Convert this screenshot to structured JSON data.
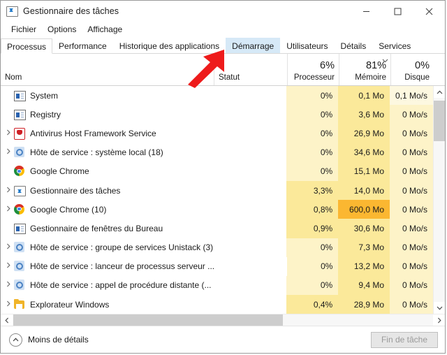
{
  "window": {
    "title": "Gestionnaire des tâches",
    "title_icon": "task-manager-icon",
    "minimize": "–",
    "maximize": "☐",
    "close": "✕"
  },
  "menubar": {
    "items": [
      {
        "label": "Fichier"
      },
      {
        "label": "Options"
      },
      {
        "label": "Affichage"
      }
    ]
  },
  "tabs": [
    {
      "label": "Processus",
      "state": "active"
    },
    {
      "label": "Performance",
      "state": "normal"
    },
    {
      "label": "Historique des applications",
      "state": "normal"
    },
    {
      "label": "Démarrage",
      "state": "hover"
    },
    {
      "label": "Utilisateurs",
      "state": "normal"
    },
    {
      "label": "Détails",
      "state": "normal"
    },
    {
      "label": "Services",
      "state": "normal"
    }
  ],
  "columns": [
    {
      "name": "Nom",
      "value": "",
      "sorted": false
    },
    {
      "name": "Statut",
      "value": "",
      "sorted": false
    },
    {
      "name": "Processeur",
      "value": "6%",
      "sorted": false
    },
    {
      "name": "Mémoire",
      "value": "81%",
      "sorted": true,
      "sort_icon": "chevron-down-icon"
    },
    {
      "name": "Disque",
      "value": "0%",
      "sorted": false
    }
  ],
  "processes": [
    {
      "name": "System",
      "icon": "windows-process-icon",
      "expandable": false,
      "status": "",
      "cpu": "0%",
      "memory": "0,1 Mo",
      "disk": "0,1 Mo/s"
    },
    {
      "name": "Registry",
      "icon": "windows-process-icon",
      "expandable": false,
      "status": "",
      "cpu": "0%",
      "memory": "3,6 Mo",
      "disk": "0 Mo/s"
    },
    {
      "name": "Antivirus Host Framework Service",
      "icon": "shield-icon",
      "expandable": true,
      "status": "",
      "cpu": "0%",
      "memory": "26,9 Mo",
      "disk": "0 Mo/s"
    },
    {
      "name": "Hôte de service : système local (18)",
      "icon": "gear-icon",
      "expandable": true,
      "status": "",
      "cpu": "0%",
      "memory": "34,6 Mo",
      "disk": "0 Mo/s"
    },
    {
      "name": "Google Chrome",
      "icon": "chrome-icon",
      "expandable": false,
      "status": "",
      "cpu": "0%",
      "memory": "15,1 Mo",
      "disk": "0 Mo/s"
    },
    {
      "name": "Gestionnaire des tâches",
      "icon": "task-manager-icon",
      "expandable": true,
      "status": "",
      "cpu": "3,3%",
      "memory": "14,0 Mo",
      "disk": "0 Mo/s"
    },
    {
      "name": "Google Chrome (10)",
      "icon": "chrome-icon",
      "expandable": true,
      "status": "",
      "cpu": "0,8%",
      "memory": "600,0 Mo",
      "disk": "0 Mo/s"
    },
    {
      "name": "Gestionnaire de fenêtres du Bureau",
      "icon": "windows-process-icon",
      "expandable": false,
      "status": "",
      "cpu": "0,9%",
      "memory": "30,6 Mo",
      "disk": "0 Mo/s"
    },
    {
      "name": "Hôte de service : groupe de services Unistack (3)",
      "icon": "gear-icon",
      "expandable": true,
      "status": "",
      "cpu": "0%",
      "memory": "7,3 Mo",
      "disk": "0 Mo/s"
    },
    {
      "name": "Hôte de service : lanceur de processus serveur ...",
      "icon": "gear-icon",
      "expandable": true,
      "status": "",
      "cpu": "0%",
      "memory": "13,2 Mo",
      "disk": "0 Mo/s"
    },
    {
      "name": "Hôte de service : appel de procédure distante (...",
      "icon": "gear-icon",
      "expandable": true,
      "status": "",
      "cpu": "0%",
      "memory": "9,4 Mo",
      "disk": "0 Mo/s"
    },
    {
      "name": "Explorateur Windows",
      "icon": "folder-icon",
      "expandable": true,
      "status": "",
      "cpu": "0,4%",
      "memory": "28,9 Mo",
      "disk": "0 Mo/s"
    }
  ],
  "statusbar": {
    "less_details": "Moins de détails",
    "less_details_icon": "chevron-up-circle-icon",
    "end_task": "Fin de tâche"
  },
  "annotation": {
    "type": "red-arrow",
    "points_to": "Démarrage",
    "color": "#ee1b1b"
  },
  "colors": {
    "heat_light": "#fdf3c8",
    "heat_mid": "#fbe99a",
    "heat_high": "#fbb731",
    "accent_tab_hover": "#d6e9f7",
    "window_border": "#9a9a9a"
  },
  "scrollbars": {
    "vertical_up": "⌃",
    "vertical_down": "⌄",
    "horizontal_left": "‹",
    "horizontal_right": "›"
  }
}
